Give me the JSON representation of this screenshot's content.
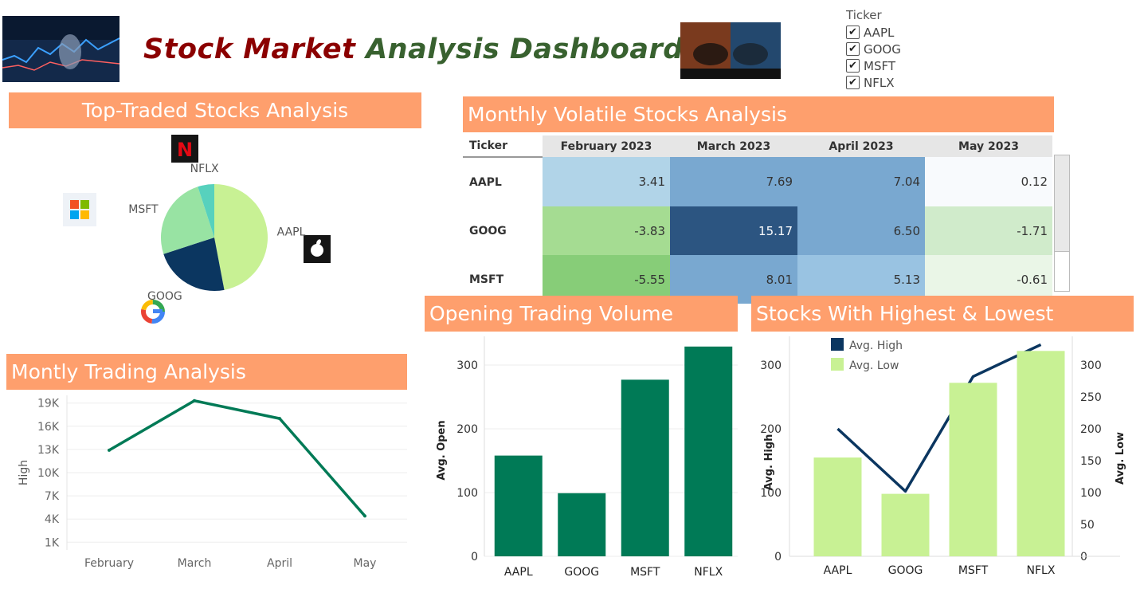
{
  "header": {
    "title_part1": "Stock Market",
    "title_part2": "Analysis Dashboard",
    "title_color1": "#8b0000",
    "title_color2": "#38612f"
  },
  "filter": {
    "label": "Ticker",
    "options": [
      "AAPL",
      "GOOG",
      "MSFT",
      "NFLX"
    ],
    "checked": [
      true,
      true,
      true,
      true
    ]
  },
  "sections": {
    "top_traded": "Top-Traded Stocks Analysis",
    "monthly_volatile": "Monthly Volatile Stocks Analysis",
    "monthly_trading": "Montly Trading Analysis",
    "opening_volume": "Opening Trading Volume",
    "highest_lowest": "Stocks With Highest & Lowest"
  },
  "icons": {
    "netflix": "netflix-logo-icon",
    "microsoft": "microsoft-logo-icon",
    "apple": "apple-logo-icon",
    "google": "google-logo-icon"
  },
  "chart_data": [
    {
      "type": "pie",
      "labels": [
        "AAPL",
        "GOOG",
        "MSFT",
        "NFLX"
      ],
      "values": [
        47,
        23,
        25,
        5
      ],
      "colors": [
        "#c8f194",
        "#0b3660",
        "#98e3a3",
        "#57d1bd"
      ]
    },
    {
      "type": "table",
      "columns": [
        "Ticker",
        "February 2023",
        "March 2023",
        "April 2023",
        "May 2023"
      ],
      "rows": [
        {
          "ticker": "AAPL",
          "values": [
            "3.41",
            "7.69",
            "7.04",
            "0.12"
          ],
          "colors": [
            "#b1d4e8",
            "#79a8d0",
            "#79a8d0",
            "#f8fafd"
          ]
        },
        {
          "ticker": "GOOG",
          "values": [
            "-3.83",
            "15.17",
            "6.50",
            "-1.71"
          ],
          "colors": [
            "#a5dc92",
            "#2c5581",
            "#79a8d0",
            "#d0ebcb"
          ]
        },
        {
          "ticker": "MSFT",
          "values": [
            "-5.55",
            "8.01",
            "5.13",
            "-0.61"
          ],
          "colors": [
            "#87cd78",
            "#79a8d0",
            "#99c3e2",
            "#eaf6e7"
          ]
        }
      ]
    },
    {
      "type": "line",
      "categories": [
        "February",
        "March",
        "April",
        "May"
      ],
      "values": [
        12900,
        19300,
        17000,
        4400
      ],
      "ylabel": "High",
      "yticks": [
        "1K",
        "4K",
        "7K",
        "10K",
        "13K",
        "16K",
        "19K"
      ],
      "ytick_values": [
        1000,
        4000,
        7000,
        10000,
        13000,
        16000,
        19000
      ],
      "ylim": [
        0,
        20000
      ],
      "color": "#007a56"
    },
    {
      "type": "bar",
      "categories": [
        "AAPL",
        "GOOG",
        "MSFT",
        "NFLX"
      ],
      "values": [
        158,
        99,
        277,
        329
      ],
      "ylabel": "Avg. Open",
      "yticks": [
        0,
        100,
        200,
        300
      ],
      "ylim": [
        0,
        345
      ],
      "color": "#007a56"
    },
    {
      "type": "bar",
      "categories": [
        "AAPL",
        "GOOG",
        "MSFT",
        "NFLX"
      ],
      "series": [
        {
          "name": "Avg. High",
          "type": "line",
          "values": [
            200,
            102,
            282,
            332
          ],
          "color": "#0b3660",
          "axis": "left"
        },
        {
          "name": "Avg. Low",
          "type": "bar",
          "values": [
            155,
            98,
            272,
            322
          ],
          "color": "#c8f194",
          "axis": "right"
        }
      ],
      "ylabel_left": "Avg. High",
      "ylabel_right": "Avg. Low",
      "yticks_left": [
        0,
        100,
        200,
        300
      ],
      "yticks_right": [
        0,
        50,
        100,
        150,
        200,
        250,
        300
      ],
      "ylim_left": [
        0,
        345
      ],
      "ylim_right": [
        0,
        345
      ],
      "legend": "top-left"
    }
  ]
}
